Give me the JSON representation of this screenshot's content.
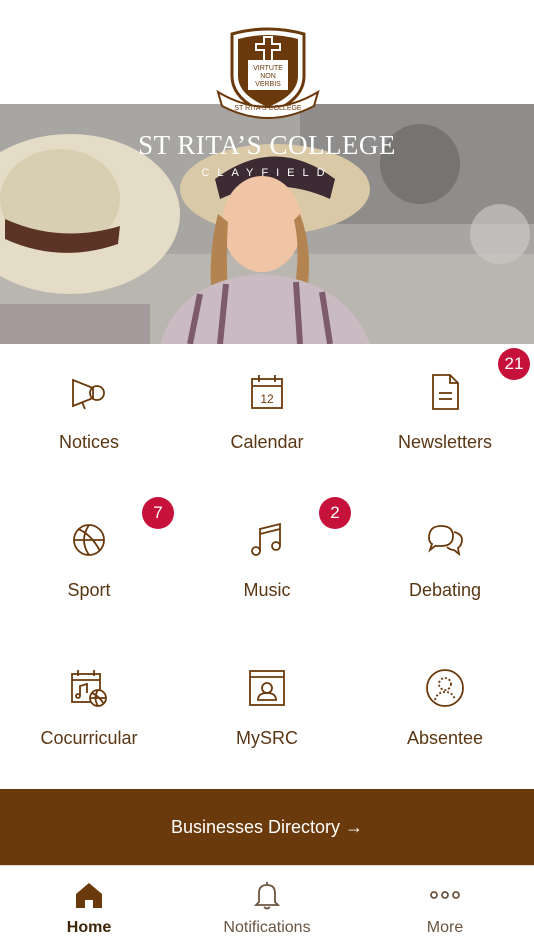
{
  "header": {
    "crest_motto": "VIRTUTE NON VERBIS",
    "crest_scroll": "ST RITA'S COLLEGE"
  },
  "hero": {
    "title": "ST RITA’S COLLEGE",
    "subtitle": "CLAYFIELD"
  },
  "tiles": [
    {
      "label": "Notices",
      "icon": "megaphone-icon",
      "badge": null
    },
    {
      "label": "Calendar",
      "icon": "calendar-icon",
      "calendar_day": "12",
      "badge": null
    },
    {
      "label": "Newsletters",
      "icon": "document-icon",
      "badge": "21"
    },
    {
      "label": "Sport",
      "icon": "basketball-icon",
      "badge": "7"
    },
    {
      "label": "Music",
      "icon": "music-note-icon",
      "badge": "2"
    },
    {
      "label": "Debating",
      "icon": "chat-bubbles-icon",
      "badge": null
    },
    {
      "label": "Cocurricular",
      "icon": "cocurricular-calendar-icon",
      "badge": null
    },
    {
      "label": "MySRC",
      "icon": "portal-window-icon",
      "badge": null
    },
    {
      "label": "Absentee",
      "icon": "person-circle-icon",
      "badge": null
    }
  ],
  "directory_button": {
    "label": "Businesses Directory →"
  },
  "tabbar": {
    "items": [
      {
        "label": "Home",
        "icon": "home-icon",
        "active": true
      },
      {
        "label": "Notifications",
        "icon": "bell-icon",
        "active": false
      },
      {
        "label": "More",
        "icon": "more-dots-icon",
        "active": false
      }
    ]
  },
  "colors": {
    "brand_brown": "#6b3a0c",
    "text_brown": "#5a3613",
    "badge_red": "#c6123b"
  }
}
